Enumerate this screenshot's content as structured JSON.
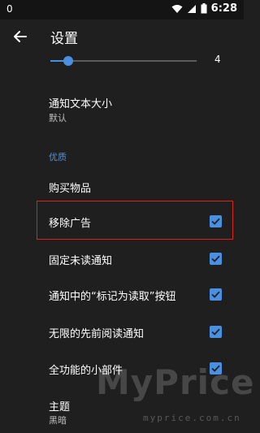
{
  "status": {
    "left_indicator": "0",
    "time": "6:28"
  },
  "header": {
    "title": "设置"
  },
  "slider": {
    "value_label": "4",
    "level_fraction": 0.12
  },
  "items": [
    {
      "title": "通知文本大小",
      "subtitle": "默认"
    },
    {
      "section": "优质"
    },
    {
      "title": "购买物品"
    },
    {
      "title": "移除广告",
      "checked": true
    },
    {
      "title": "固定未读通知",
      "checked": true
    },
    {
      "title": "通知中的“标记为读取”按钮",
      "checked": true
    },
    {
      "title": "无限的先前阅读通知",
      "checked": true
    },
    {
      "title": "全功能的小部件",
      "checked": true
    },
    {
      "title": "主题",
      "subtitle": "黑暗"
    }
  ],
  "watermark": {
    "brand": "MyPrice",
    "url": "myprice.com.cn"
  },
  "colors": {
    "accent": "#4a8fe0",
    "highlight_border": "#e0201f",
    "background": "#1f1f1f",
    "section": "#5d8fd1"
  }
}
